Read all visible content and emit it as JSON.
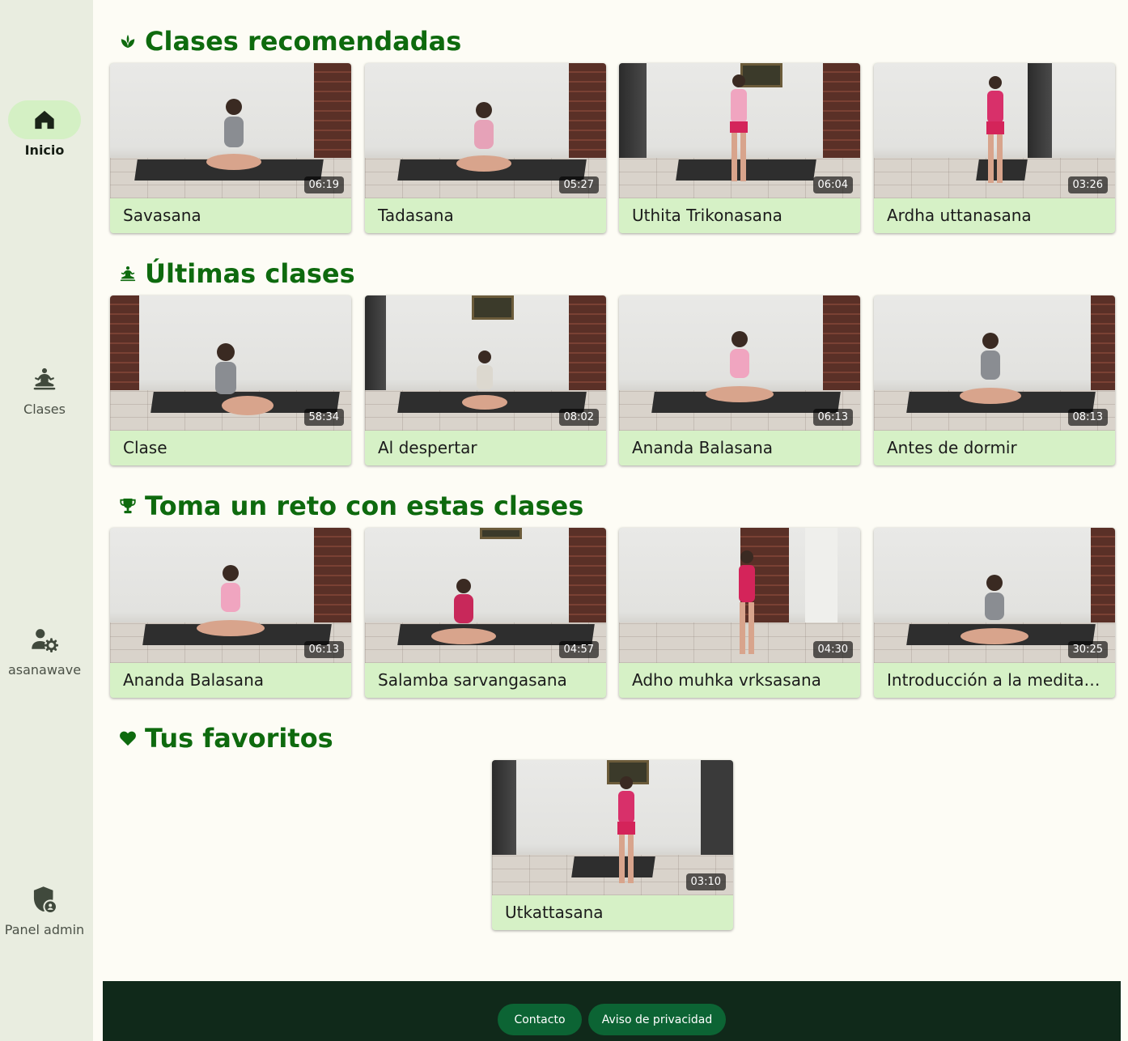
{
  "sidebar": {
    "items": [
      {
        "label": "Inicio",
        "icon": "home-icon",
        "active": true
      },
      {
        "label": "Clases",
        "icon": "meditation-icon",
        "active": false
      },
      {
        "label": "asanawave",
        "icon": "user-settings-icon",
        "active": false
      },
      {
        "label": "Panel admin",
        "icon": "admin-shield-icon",
        "active": false
      }
    ]
  },
  "sections": [
    {
      "title": "Clases recomendadas",
      "icon": "leaf-icon",
      "cards": [
        {
          "title": "Savasana",
          "duration": "06:19"
        },
        {
          "title": "Tadasana",
          "duration": "05:27"
        },
        {
          "title": "Uthita Trikonasana",
          "duration": "06:04"
        },
        {
          "title": "Ardha uttanasana",
          "duration": "03:26"
        }
      ]
    },
    {
      "title": "Últimas clases",
      "icon": "meditation-icon",
      "cards": [
        {
          "title": "Clase",
          "duration": "58:34"
        },
        {
          "title": "Al despertar",
          "duration": "08:02"
        },
        {
          "title": "Ananda Balasana",
          "duration": "06:13"
        },
        {
          "title": "Antes de dormir",
          "duration": "08:13"
        }
      ]
    },
    {
      "title": "Toma un reto con estas clases",
      "icon": "trophy-icon",
      "cards": [
        {
          "title": "Ananda Balasana",
          "duration": "06:13"
        },
        {
          "title": "Salamba sarvangasana",
          "duration": "04:57"
        },
        {
          "title": "Adho muhka vrksasana",
          "duration": "04:30"
        },
        {
          "title": "Introducción a la meditación",
          "duration": "30:25"
        }
      ]
    },
    {
      "title": "Tus favoritos",
      "icon": "heart-icon",
      "cards": [
        {
          "title": "Utkattasana",
          "duration": "03:10"
        }
      ]
    }
  ],
  "footer": {
    "buttons": [
      {
        "label": "Contacto"
      },
      {
        "label": "Aviso de privacidad"
      }
    ]
  },
  "colors": {
    "accent": "#0e6a0e",
    "card_bg": "#d6f1c6",
    "sidebar_bg": "#e9ede0",
    "footer_bg": "#10291a",
    "footer_button": "#0c6434"
  }
}
